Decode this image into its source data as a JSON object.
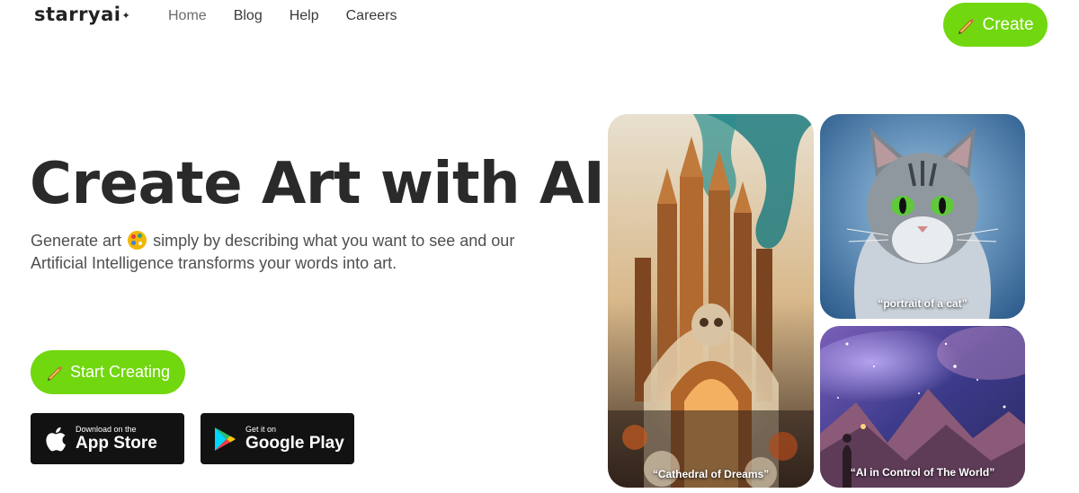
{
  "header": {
    "logo_text": "starryai",
    "nav": [
      {
        "label": "Home"
      },
      {
        "label": "Blog"
      },
      {
        "label": "Help"
      },
      {
        "label": "Careers"
      }
    ],
    "create_label": "Create"
  },
  "hero": {
    "title": "Create Art with AI",
    "subtitle_part1": "Generate art",
    "subtitle_part2": "simply by describing what you want to see and our Artificial Intelligence transforms your words into art.",
    "start_label": "Start Creating"
  },
  "stores": {
    "apple": {
      "small": "Download on the",
      "big": "App Store"
    },
    "google": {
      "small": "Get it on",
      "big": "Google Play"
    }
  },
  "gallery": [
    {
      "caption": "“Cathedral of Dreams”"
    },
    {
      "caption": "“portrait of a cat”"
    },
    {
      "caption": "“AI in Control of The World”"
    }
  ],
  "colors": {
    "accent": "#71d70f",
    "store_bg": "#121212"
  },
  "icons": [
    "sparkle-icon",
    "pencil-icon",
    "palette-icon",
    "apple-icon",
    "google-play-icon"
  ]
}
